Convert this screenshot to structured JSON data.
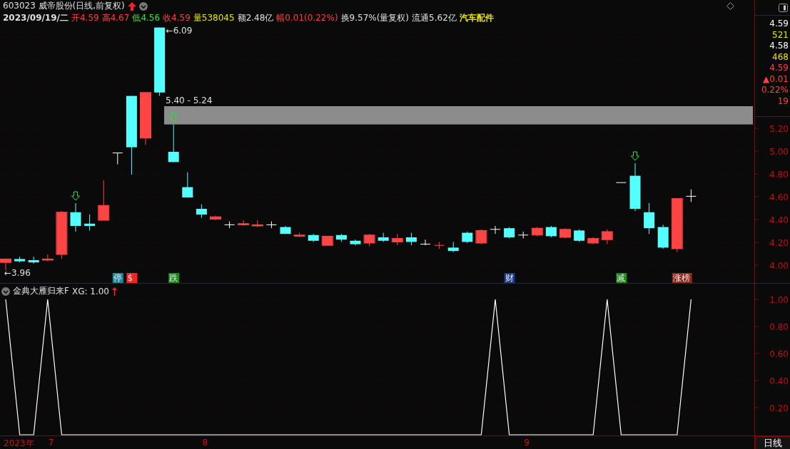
{
  "header": {
    "title": "603023 威帝股份(日线,前复权)",
    "quote": [
      {
        "label": "2023/09/19/二",
        "color": "#e0e0e0"
      },
      {
        "label": "开",
        "value": "4.59",
        "color": "#ff4040"
      },
      {
        "label": "高",
        "value": "4.67",
        "color": "#ff4040"
      },
      {
        "label": "低",
        "value": "4.56",
        "color": "#40e040"
      },
      {
        "label": "收",
        "value": "4.59",
        "color": "#ff4040"
      },
      {
        "label": "量",
        "value": "538045",
        "color": "#e6e600"
      },
      {
        "label": "额",
        "value": "2.48亿",
        "color": "#e0e0e0"
      },
      {
        "label": "幅",
        "value": "0.01(0.22%)",
        "color": "#ff4040"
      },
      {
        "label": "换",
        "value": "9.57%(量复权)",
        "color": "#e0e0e0"
      },
      {
        "label": "流通",
        "value": "5.62亿",
        "color": "#e0e0e0"
      },
      {
        "label": "汽车配件",
        "color": "#e6e600"
      }
    ]
  },
  "price_chart": {
    "high_label": "←6.09",
    "low_label": "←3.96",
    "range_label": "5.40 - 5.24",
    "signals": [
      {
        "text": "停",
        "color": "#1a8a9a"
      },
      {
        "text": "$",
        "color": "#ff2020"
      },
      {
        "text": "跌",
        "color": "#1a8a1a"
      },
      {
        "text": "财",
        "color": "#1a3a8a"
      },
      {
        "text": "减",
        "color": "#1a8a1a"
      },
      {
        "text": "涨榜",
        "color": "#8a2a1a"
      }
    ],
    "yticks": [
      "5.20",
      "5.00",
      "4.80",
      "4.60",
      "4.40",
      "4.20",
      "4.00"
    ]
  },
  "quote_panel": [
    {
      "text": "4.59",
      "color": "#ffffff"
    },
    {
      "text": "521",
      "color": "#e6e600"
    },
    {
      "text": "4.58",
      "color": "#ffffff"
    },
    {
      "text": "468",
      "color": "#e6e600"
    },
    {
      "text": "4.59",
      "color": "#ff4040"
    },
    {
      "text": "▲0.01",
      "color": "#ff4040"
    },
    {
      "text": "0.22%",
      "color": "#ff4040"
    },
    {
      "text": "19",
      "color": "#ff4040"
    }
  ],
  "indicator": {
    "name": "金典大雁归来F",
    "reading": "XG: 1.00",
    "chart_data": {
      "type": "line",
      "grid": true,
      "ylim": [
        0,
        1
      ],
      "yticks": [
        {
          "value": 1,
          "label": "1.00"
        },
        {
          "value": 0.8,
          "label": "0.80"
        },
        {
          "value": 0.6,
          "label": "0.60"
        },
        {
          "value": 0.4,
          "label": "0.40"
        },
        {
          "value": 0.2,
          "label": "0.20"
        }
      ],
      "series": [
        {
          "color": "#ffffff",
          "values": [
            1,
            0,
            0,
            1,
            0,
            0,
            0,
            0,
            0,
            0,
            0,
            0,
            0,
            0,
            0,
            0,
            0,
            0,
            0,
            0,
            0,
            0,
            0,
            0,
            0,
            0,
            0,
            0,
            0,
            0,
            0,
            0,
            0,
            0,
            0,
            1,
            0,
            0,
            0,
            0,
            0,
            0,
            0,
            1,
            0,
            0,
            0,
            0,
            0,
            1
          ]
        }
      ]
    }
  },
  "date_axis": [
    "2023年",
    "7",
    "8",
    "9"
  ],
  "period_tab": {
    "label": "日线",
    "selected": true
  }
}
